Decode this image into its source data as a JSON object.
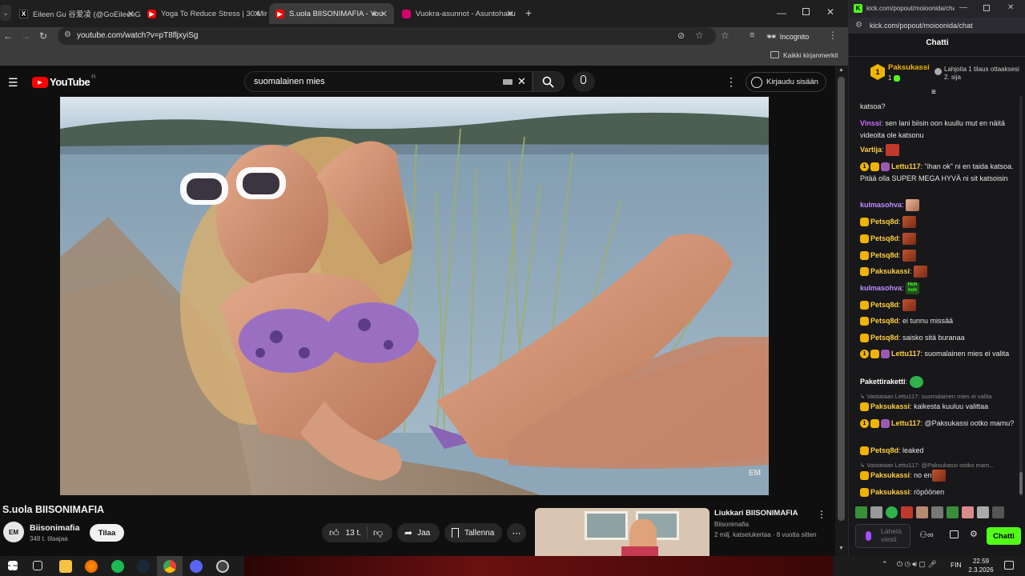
{
  "browser": {
    "tabs": [
      {
        "label": "Eileen Gu 谷爱凌 (@GoEileenG",
        "favicon": "x-icon"
      },
      {
        "label": "Yoga To Reduce Stress | 30 Min",
        "favicon": "youtube-icon"
      },
      {
        "label": "S.uola BIISONIMAFIA - You",
        "favicon": "youtube-icon",
        "active": true
      },
      {
        "label": "Vuokra-asunnot - Asuntohaku",
        "favicon": "oikotie-icon"
      }
    ],
    "new_tab": "+",
    "url": "youtube.com/watch?v=pT8fljxyiSg",
    "incognito_label": "Incognito",
    "bookmarks_label": "Kaikki kirjanmerkit"
  },
  "youtube": {
    "logo_text": "YouTube",
    "logo_region": "FI",
    "search_value": "suomalainen mies",
    "signin_label": "Kirjaudu sisään",
    "video_title": "S.uola BIISONIMAFIA",
    "channel_name": "Biisonimafia",
    "subscribers": "348 t. tilaajaa",
    "subscribe_label": "Tilaa",
    "likes": "13 t.",
    "share_label": "Jaa",
    "save_label": "Tallenna",
    "watermark": "EM",
    "channel_avatar_text": "EM",
    "recommended": {
      "title": "Liukkari  BIISONIMAFIA",
      "channel": "Biisonimafia",
      "meta": "2 milj. katselukertaa · 8 vuotta sitten"
    }
  },
  "chat": {
    "popup_url": "kick.com/popout/moioonida/chat",
    "title": "Chatti",
    "pinned_user": "Paksukassi",
    "pinned_count": "1",
    "pinned_rank": "1",
    "gift_text": "Lahjoita 1 tilaus ottaaksesi 2. sija",
    "messages": [
      {
        "user": "",
        "text": "katsoa?"
      },
      {
        "user": "Vinssi",
        "text": "sen lani biisin oon kuullu mut en näitä videoita ole katsonu"
      },
      {
        "user": "Vartija",
        "text": ""
      },
      {
        "user": "Lettu117",
        "text": "\"ihan ok\" ni en taida katsoa. Pitää olla SUPER MEGA HYVÄ ni sit katsoisin"
      },
      {
        "user": "kulmasohva",
        "text": ""
      },
      {
        "user": "Petsq8d",
        "text": ""
      },
      {
        "user": "Petsq8d",
        "text": ""
      },
      {
        "user": "Petsq8d",
        "text": ""
      },
      {
        "user": "Paksukassi",
        "text": ""
      },
      {
        "user": "kulmasohva",
        "text": ""
      },
      {
        "user": "Petsq8d",
        "text": ""
      },
      {
        "user": "Petsq8d",
        "text": "ei tunnu missää"
      },
      {
        "user": "Petsq8d",
        "text": "saisko sitä buranaa"
      },
      {
        "user": "Lettu117",
        "text": "suomalainen mies ei valita"
      },
      {
        "user": "Pakettiraketti",
        "text": ""
      },
      {
        "reply": "Vastataan Lettu117: suomalainen mies ei valita"
      },
      {
        "user": "Paksukassi",
        "text": "kaikesta kuuluu valittaa"
      },
      {
        "user": "Lettu117",
        "text": "@Paksukassi ootko mamu?"
      },
      {
        "user": "Petsq8d",
        "text": "leaked"
      },
      {
        "reply": "Vastataan Lettu117: @Paksukassi ootko mam..."
      },
      {
        "user": "Paksukassi",
        "text": "no en"
      },
      {
        "user": "Paksukassi",
        "text": "röpöönen"
      }
    ],
    "emote_label": "Hoh hoh",
    "input_placeholder": "Lähetä viesti",
    "send_label": "Chatti"
  },
  "taskbar": {
    "lang": "FIN",
    "time": "22.59",
    "date": "2.3.2026"
  },
  "colors": {
    "kick_green": "#53fc18",
    "youtube_red": "#ff0000",
    "chat_bg": "#18181b"
  }
}
